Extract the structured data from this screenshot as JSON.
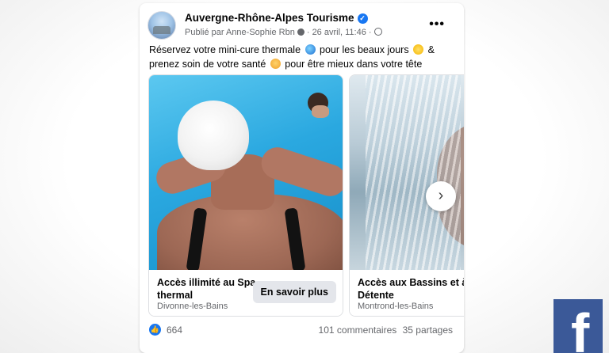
{
  "post": {
    "page_name": "Auvergne-Rhône-Alpes Tourisme",
    "meta_published": "Publié par Anne-Sophie Rbn",
    "meta_date": "26 avril, 11:46",
    "more_label": "•••",
    "text_part1": "Réservez votre mini-cure thermale",
    "text_part2": "pour les beaux jours",
    "text_part3": "&",
    "text_part4": "prenez soin de votre santé",
    "text_part5": "pour être mieux dans votre tête"
  },
  "carousel": {
    "items": [
      {
        "title": "Accès illimité au Spa thermal",
        "subtitle": "Divonne-les-Bains",
        "cta": "En savoir plus"
      },
      {
        "title": "Accès aux Bassins et à l'Espace Détente",
        "subtitle": "Montrond-les-Bains"
      }
    ],
    "next_icon": "›"
  },
  "footer": {
    "likes": "664",
    "comments": "101 commentaires",
    "shares": "35 partages"
  },
  "brand": {
    "logo_letter": "f",
    "accent": "#1877f2",
    "logo_bg": "#3b5998"
  }
}
